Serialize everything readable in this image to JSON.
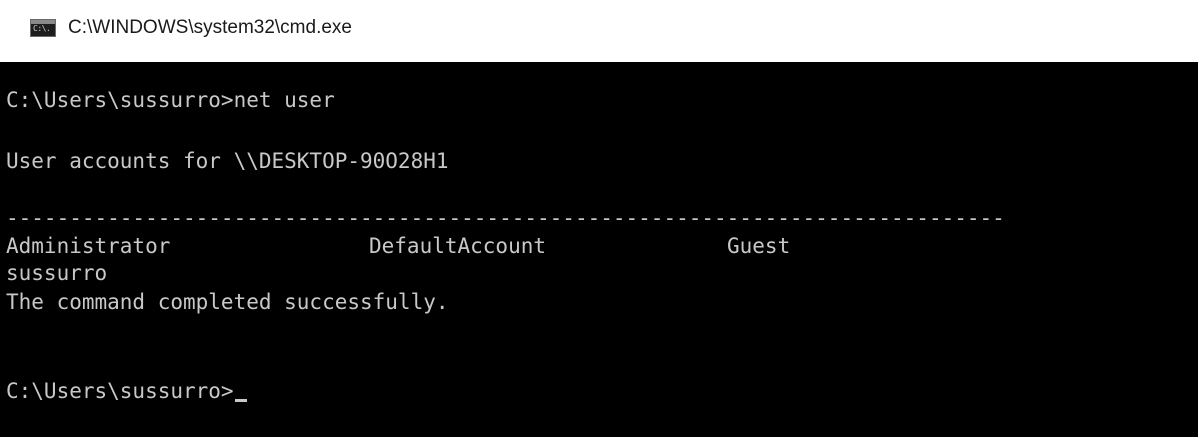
{
  "window": {
    "title": "C:\\WINDOWS\\system32\\cmd.exe",
    "icon": "cmd-console-icon",
    "icon_glyph": "C:\\."
  },
  "console": {
    "prompt_command": "C:\\Users\\sussurro>net user",
    "header": "User accounts for \\\\DESKTOP-90O28H1",
    "separator": "-------------------------------------------------------------------------------",
    "accounts_row1": [
      "Administrator",
      "DefaultAccount",
      "Guest"
    ],
    "accounts_row2": [
      "sussurro"
    ],
    "status": "The command completed successfully.",
    "prompt": "C:\\Users\\sussurro>"
  }
}
